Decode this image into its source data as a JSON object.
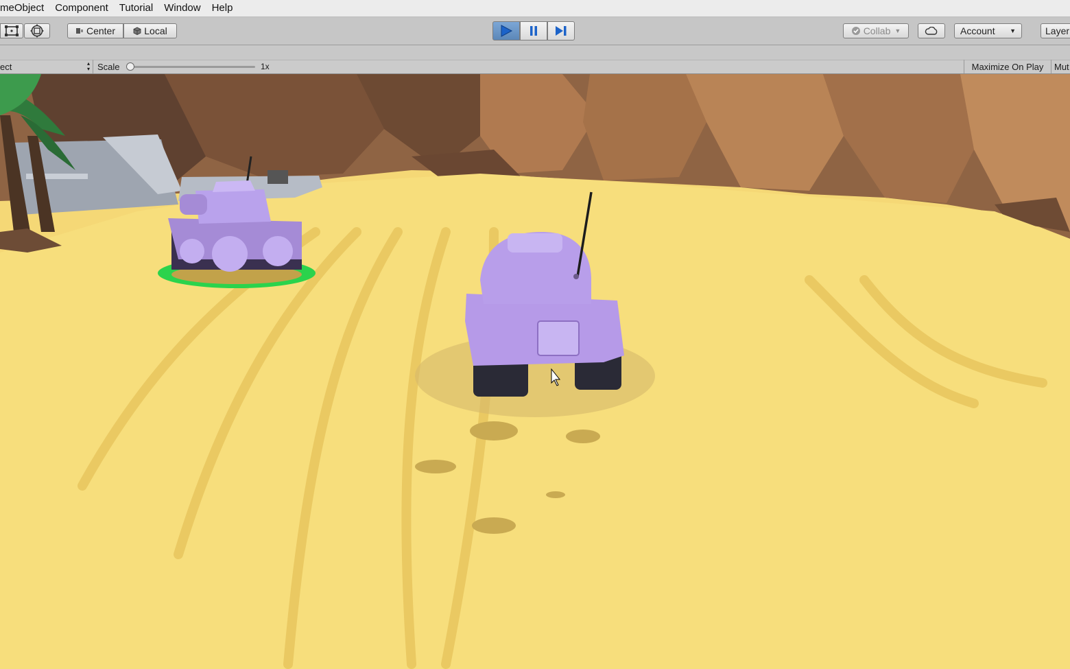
{
  "menu": [
    "meObject",
    "Component",
    "Tutorial",
    "Window",
    "Help"
  ],
  "toolbar": {
    "pivot_label": "Center",
    "space_label": "Local",
    "collab_label": "Collab",
    "account_label": "Account",
    "layers_label": "Layer"
  },
  "game_view": {
    "aspect_label": "ect",
    "scale_label": "Scale",
    "scale_value": "1x",
    "scale_fraction": 0.0,
    "maximize_label": "Maximize On Play",
    "mute_label": "Mut"
  },
  "colors": {
    "play_active": "#6b96c8",
    "sand": "#f3d672",
    "rock": "#9a6b48",
    "tank": "#b79be6",
    "selection_ring": "#29d44a"
  }
}
